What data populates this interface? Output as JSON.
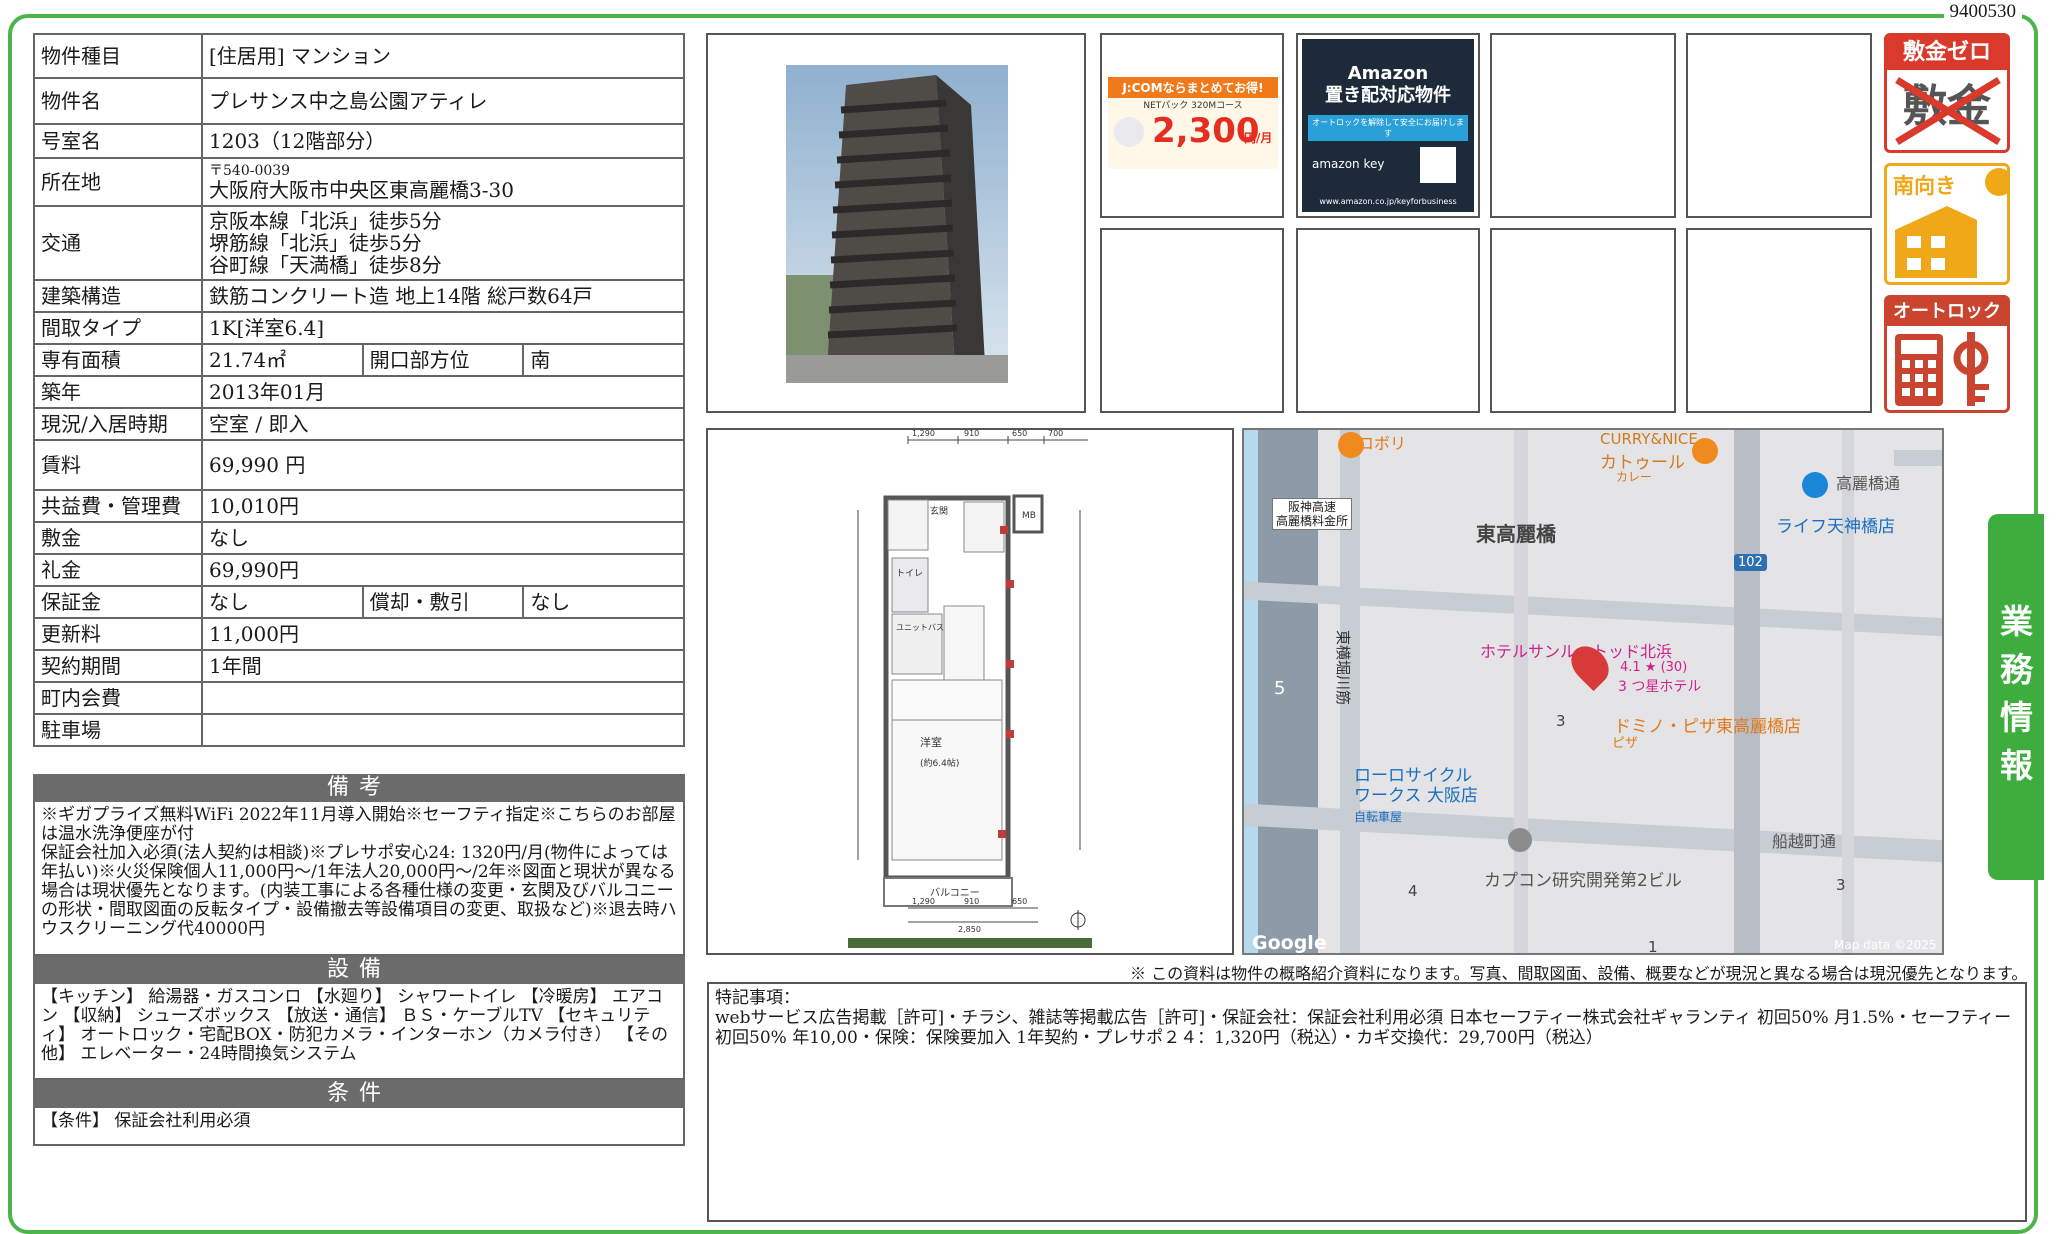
{
  "doc_number": "9400530",
  "side_tab": "業務情報",
  "spec": {
    "property_type": {
      "label": "物件種目",
      "value": "[住居用] マンション"
    },
    "property_name": {
      "label": "物件名",
      "value": "プレサンス中之島公園アティレ"
    },
    "room_no": {
      "label": "号室名",
      "value": "1203（12階部分）"
    },
    "address": {
      "label": "所在地",
      "zip": "〒540-0039",
      "value": "大阪府大阪市中央区東高麗橋3-30"
    },
    "transport": {
      "label": "交通",
      "lines": [
        "京阪本線「北浜」徒歩5分",
        "堺筋線「北浜」徒歩5分",
        "谷町線「天満橋」徒歩8分"
      ]
    },
    "structure": {
      "label": "建築構造",
      "value": "鉄筋コンクリート造 地上14階 総戸数64戸"
    },
    "layout": {
      "label": "間取タイプ",
      "value": "1K[洋室6.4]"
    },
    "area": {
      "label": "専有面積",
      "value": "21.74㎡",
      "sub_label": "開口部方位",
      "sub_value": "南"
    },
    "built": {
      "label": "築年",
      "value": "2013年01月"
    },
    "status": {
      "label": "現況/入居時期",
      "value": "空室 / 即入"
    },
    "rent": {
      "label": "賃料",
      "value": "69,990 円"
    },
    "mgmt_fee": {
      "label": "共益費・管理費",
      "value": "10,010円"
    },
    "deposit": {
      "label": "敷金",
      "value": "なし"
    },
    "key_money": {
      "label": "礼金",
      "value": "69,990円"
    },
    "guarantee": {
      "label": "保証金",
      "value": "なし",
      "sub_label": "償却・敷引",
      "sub_value": "なし"
    },
    "renewal": {
      "label": "更新料",
      "value": "11,000円"
    },
    "contract": {
      "label": "契約期間",
      "value": "1年間"
    },
    "town_fee": {
      "label": "町内会費",
      "value": ""
    },
    "parking": {
      "label": "駐車場",
      "value": ""
    }
  },
  "remarks": {
    "header": "備考",
    "text": "※ギガプライズ無料WiFi 2022年11月導入開始※セーフティ指定※こちらのお部屋は温水洗浄便座が付\n保証会社加入必須(法人契約は相談)※プレサポ安心24: 1320円/月(物件によっては年払い)※火災保険個人11,000円～/1年法人20,000円～/2年※図面と現状が異なる場合は現状優先となります。(内装工事による各種仕様の変更・玄関及びバルコニーの形状・間取図面の反転タイプ・設備撤去等設備項目の変更、取扱など)※退去時ハウスクリーニング代40000円"
  },
  "equipment": {
    "header": "設備",
    "text": "【キッチン】 給湯器・ガスコンロ 【水廻り】 シャワートイレ 【冷暖房】 エアコン 【収納】 シューズボックス 【放送・通信】 ＢＳ・ケーブルTV 【セキュリティ】 オートロック・宅配BOX・防犯カメラ・インターホン（カメラ付き） 【その他】 エレベーター・24時間換気システム"
  },
  "conditions": {
    "header": "条件",
    "text": "【条件】 保証会社利用必須"
  },
  "badges": {
    "zero_deposit": "敷金ゼロ",
    "crossed": "敷金",
    "south": "南向き",
    "autolock": "オートロック"
  },
  "ads": {
    "jcom_title": "J:COMならまとめてお得!",
    "jcom_sub": "NETパック 320Mコース",
    "jcom_price": "2,300",
    "jcom_unit": "円/月",
    "amazon_title": "Amazon\n置き配対応物件",
    "amazon_sub": "オートロックを解除して安全にお届けします",
    "amazon_key": "amazon key",
    "amazon_url": "www.amazon.co.jp/keyforbusiness"
  },
  "floorplan": {
    "room": "洋室",
    "room_size": "(約6.4帖)",
    "balcony": "バルコニー",
    "entry": "玄関",
    "bath": "ユニットバス",
    "toilet": "トイレ",
    "mb": "MB",
    "dims_top": [
      "1,290",
      "910",
      "650",
      "700"
    ],
    "dims_bottom": [
      "1,290",
      "910",
      "650"
    ],
    "width_total": "2,850"
  },
  "map": {
    "labels": {
      "area": "東高麗橋",
      "curry": "CURRY&NICE",
      "curry2": "カトゥール",
      "curry3": "カレー",
      "yokobori": "ヨコボリ",
      "toll": "阪神高速\n高麗橋料金所",
      "life": "ライフ天神橋店",
      "kouraibashi": "高麗橋通",
      "hotel": "ホテルサンルートッド北浜",
      "hotel_rating": "4.1 ★ (30)",
      "hotel_type": "3 つ星ホテル",
      "domino": "ドミノ・ピザ東高麗橋店",
      "pizza": "ピザ",
      "cycle": "ローロサイクル\nワークス 大阪店",
      "cycle_type": "自転車屋",
      "capcom": "カプコン研究開発第2ビル",
      "funakoshi": "船越町通",
      "higashiyokobori": "東横堀川筋",
      "route": "102",
      "num5": "5",
      "num3a": "3",
      "num3b": "3",
      "num4": "4",
      "num1": "1",
      "google": "Google",
      "copyright": "Map data ©2025"
    }
  },
  "notice": "※ この資料は物件の概略紹介資料になります。写真、間取図面、設備、概要などが現況と異なる場合は現況優先となります。",
  "special": {
    "title": "特記事項：",
    "text": "webサービス広告掲載［許可]・チラシ、雑誌等掲載広告［許可]・保証会社：保証会社利用必須 日本セーフティー株式会社ギャランティ 初回50% 月1.5%・セーフティー 初回50% 年10,00・保険：保険要加入 1年契約・プレサポ２４：1,320円（税込）・カギ交換代：29,700円（税込）"
  }
}
